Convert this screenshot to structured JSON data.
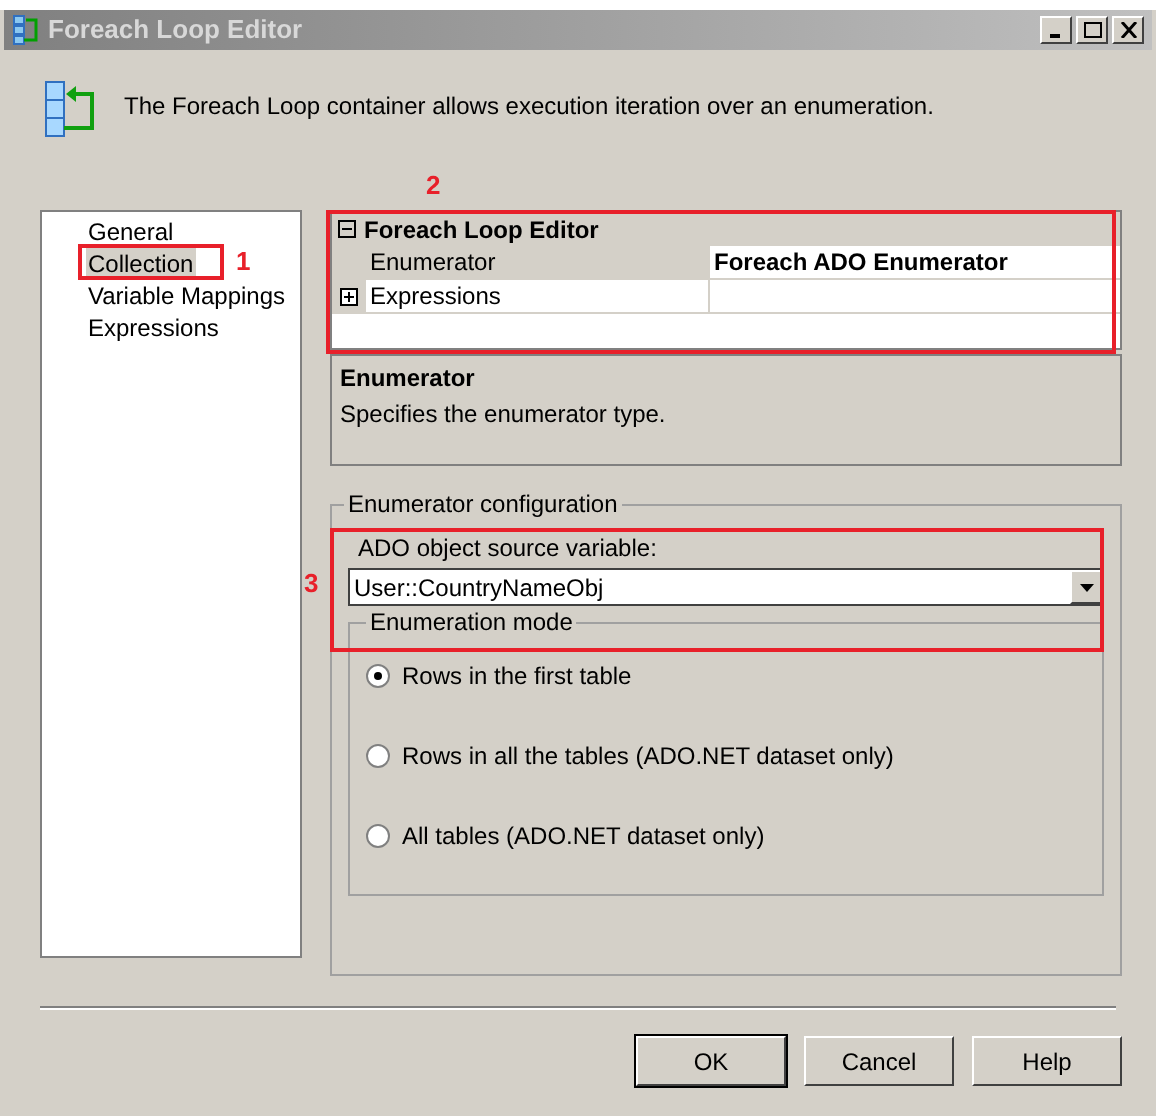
{
  "window": {
    "title": "Foreach Loop Editor"
  },
  "header": {
    "text": "The Foreach Loop container allows execution iteration over an enumeration."
  },
  "nav": [
    {
      "label": "General",
      "selected": false
    },
    {
      "label": "Collection",
      "selected": true
    },
    {
      "label": "Variable Mappings",
      "selected": false
    },
    {
      "label": "Expressions",
      "selected": false
    }
  ],
  "property_grid": {
    "category": "Foreach Loop Editor",
    "expanded": true,
    "rows": [
      {
        "name": "Enumerator",
        "value": "Foreach ADO Enumerator",
        "expandable": false,
        "selected": true
      },
      {
        "name": "Expressions",
        "value": "",
        "expandable": true,
        "selected": false
      }
    ]
  },
  "description": {
    "title": "Enumerator",
    "text": "Specifies the enumerator type."
  },
  "config": {
    "title": "Enumerator configuration",
    "field_label": "ADO object source variable:",
    "field_value": "User::CountryNameObj",
    "mode_title": "Enumeration mode",
    "modes": [
      {
        "label": "Rows in the first table",
        "selected": true
      },
      {
        "label": "Rows in all the tables (ADO.NET dataset only)",
        "selected": false
      },
      {
        "label": "All tables (ADO.NET dataset only)",
        "selected": false
      }
    ]
  },
  "buttons": [
    {
      "label": "OK",
      "default": true
    },
    {
      "label": "Cancel",
      "default": false
    },
    {
      "label": "Help",
      "default": false
    }
  ],
  "annotations": [
    {
      "label": "1"
    },
    {
      "label": "2"
    },
    {
      "label": "3"
    }
  ]
}
